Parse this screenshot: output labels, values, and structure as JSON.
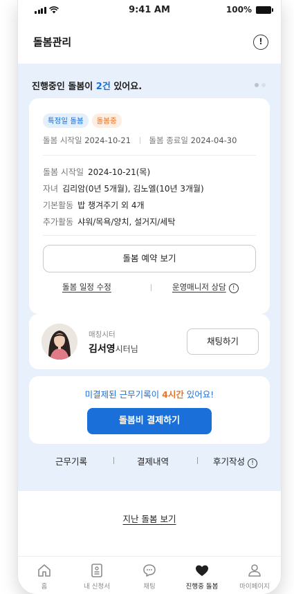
{
  "status_bar": {
    "time": "9:41 AM",
    "battery": "100%"
  },
  "header": {
    "title": "돌봄관리",
    "info_icon": "!"
  },
  "progress": {
    "prefix": "진행중인 돌봄이 ",
    "count": "2건",
    "suffix": " 있어요.",
    "carousel": {
      "pages": 2,
      "active": 1
    }
  },
  "care_card": {
    "badges": [
      "특정일 돌봄",
      "돌봄중"
    ],
    "start_label": "돌봄 시작일",
    "start_date": "2024-10-21",
    "end_label": "돌봄 종료일",
    "end_date": "2024-04-30",
    "rows": [
      {
        "label": "돌봄 시작일",
        "value": "2024-10-21(목)"
      },
      {
        "label": "자녀",
        "value": "김리암(0년 5개월), 김노엘(10년 3개월)"
      },
      {
        "label": "기본활동",
        "value": "밥 챙겨주기 외 4개"
      },
      {
        "label": "추가활동",
        "value": "샤워/목욕/양치, 설거지/세탁"
      }
    ],
    "view_reservation_button": "돌봄 예약 보기",
    "edit_schedule_link": "돌봄 일정 수정",
    "consult_link": "운영매니저 상담"
  },
  "sitter_card": {
    "sub_label": "매칭시터",
    "name": "김서영",
    "suffix": "시터님",
    "chat_button": "채팅하기"
  },
  "payment_card": {
    "msg_prefix": "미결제된 근무기록이 ",
    "hours": "4시간",
    "msg_suffix": " 있어요!",
    "pay_button": "돌봄비 결제하기"
  },
  "bottom_links": {
    "work_record": "근무기록",
    "payment_history": "결제내역",
    "review": "후기작성"
  },
  "past_link": "지난 돌봄 보기",
  "tabs": [
    {
      "label": "홈",
      "icon": "home-icon"
    },
    {
      "label": "내 신청서",
      "icon": "application-icon"
    },
    {
      "label": "채팅",
      "icon": "chat-icon"
    },
    {
      "label": "진행중 돌봄",
      "icon": "heart-icon",
      "active": true
    },
    {
      "label": "마이페이지",
      "icon": "person-icon"
    }
  ],
  "colors": {
    "accent": "#1b6fd8",
    "highlight": "#e8742a",
    "section_bg": "#e8f1fb"
  }
}
